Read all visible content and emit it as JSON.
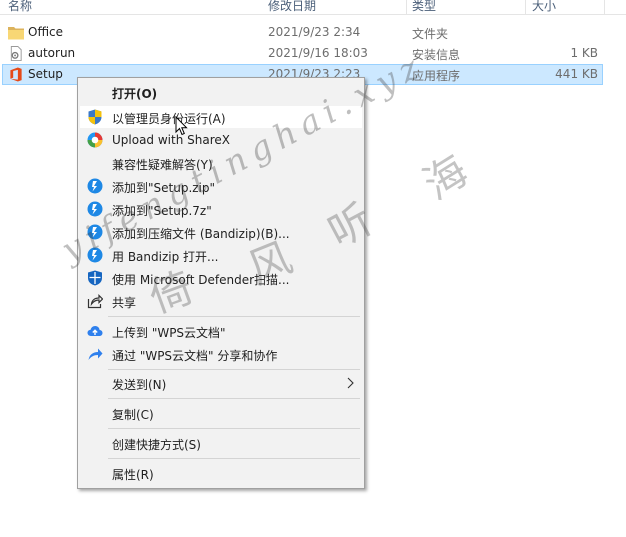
{
  "columns": {
    "name": "名称",
    "modified": "修改日期",
    "type": "类型",
    "size": "大小"
  },
  "files": [
    {
      "name": "Office",
      "modified": "2021/9/23 2:34",
      "type": "文件夹",
      "size": "",
      "icon": "folder-icon",
      "selected": false
    },
    {
      "name": "autorun",
      "modified": "2021/9/16 18:03",
      "type": "安装信息",
      "size": "1 KB",
      "icon": "settings-file-icon",
      "selected": false
    },
    {
      "name": "Setup",
      "modified": "2021/9/23 2:23",
      "type": "应用程序",
      "size": "441 KB",
      "icon": "office-app-icon",
      "selected": true
    }
  ],
  "context_menu": {
    "items": [
      {
        "label": "打开(O)",
        "icon": "",
        "bold": true
      },
      {
        "label": "以管理员身份运行(A)",
        "icon": "uac-shield-icon",
        "hover": true
      },
      {
        "label": "Upload with ShareX",
        "icon": "sharex-icon"
      },
      {
        "label": "兼容性疑难解答(Y)",
        "icon": ""
      },
      {
        "label": "添加到\"Setup.zip\"",
        "icon": "bandizip-icon"
      },
      {
        "label": "添加到\"Setup.7z\"",
        "icon": "bandizip-icon"
      },
      {
        "label": "添加到压缩文件 (Bandizip)(B)...",
        "icon": "bandizip-icon"
      },
      {
        "label": "用 Bandizip 打开...",
        "icon": "bandizip-icon"
      },
      {
        "label": "使用 Microsoft Defender扫描...",
        "icon": "defender-icon"
      },
      {
        "label": "共享",
        "icon": "share-icon"
      },
      {
        "label": "上传到 \"WPS云文档\"",
        "icon": "wps-cloud-upload-icon"
      },
      {
        "label": "通过 \"WPS云文档\" 分享和协作",
        "icon": "wps-share-icon"
      },
      {
        "label": "发送到(N)",
        "icon": "",
        "submenu": true
      },
      {
        "label": "复制(C)",
        "icon": ""
      },
      {
        "label": "创建快捷方式(S)",
        "icon": ""
      },
      {
        "label": "属性(R)",
        "icon": ""
      }
    ]
  },
  "watermark": {
    "latin": "yifengtinghai.xyz",
    "cjk": [
      "倚",
      "风",
      "听",
      "海"
    ]
  },
  "colors": {
    "selection": "#cce8ff",
    "selection_border": "#99d1ff",
    "menu_bg": "#f2f2f2",
    "bandizip": "#1e88e5"
  }
}
